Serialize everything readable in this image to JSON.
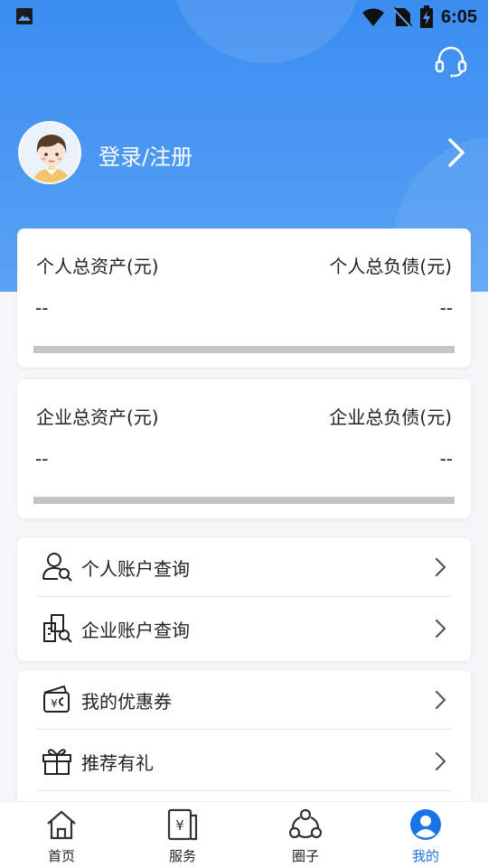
{
  "status_bar": {
    "time": "6:05"
  },
  "header": {
    "login_label": "登录/注册"
  },
  "personal_assets": {
    "assets_label": "个人总资产(元)",
    "liabilities_label": "个人总负债(元)",
    "assets_value": "--",
    "liabilities_value": "--"
  },
  "enterprise_assets": {
    "assets_label": "企业总资产(元)",
    "liabilities_label": "企业总负债(元)",
    "assets_value": "--",
    "liabilities_value": "--"
  },
  "account_menu": [
    {
      "label": "个人账户查询",
      "icon": "user-search-icon"
    },
    {
      "label": "企业账户查询",
      "icon": "building-search-icon"
    }
  ],
  "benefits_menu": [
    {
      "label": "我的优惠券",
      "icon": "coupon-wallet-icon"
    },
    {
      "label": "推荐有礼",
      "icon": "gift-icon"
    }
  ],
  "tabbar": {
    "items": [
      {
        "label": "首页",
        "icon": "home-icon"
      },
      {
        "label": "服务",
        "icon": "service-icon"
      },
      {
        "label": "圈子",
        "icon": "community-icon"
      },
      {
        "label": "我的",
        "icon": "profile-icon"
      }
    ],
    "active_index": 3
  },
  "colors": {
    "accent": "#1a73e8",
    "hero": "#3a8df0"
  }
}
